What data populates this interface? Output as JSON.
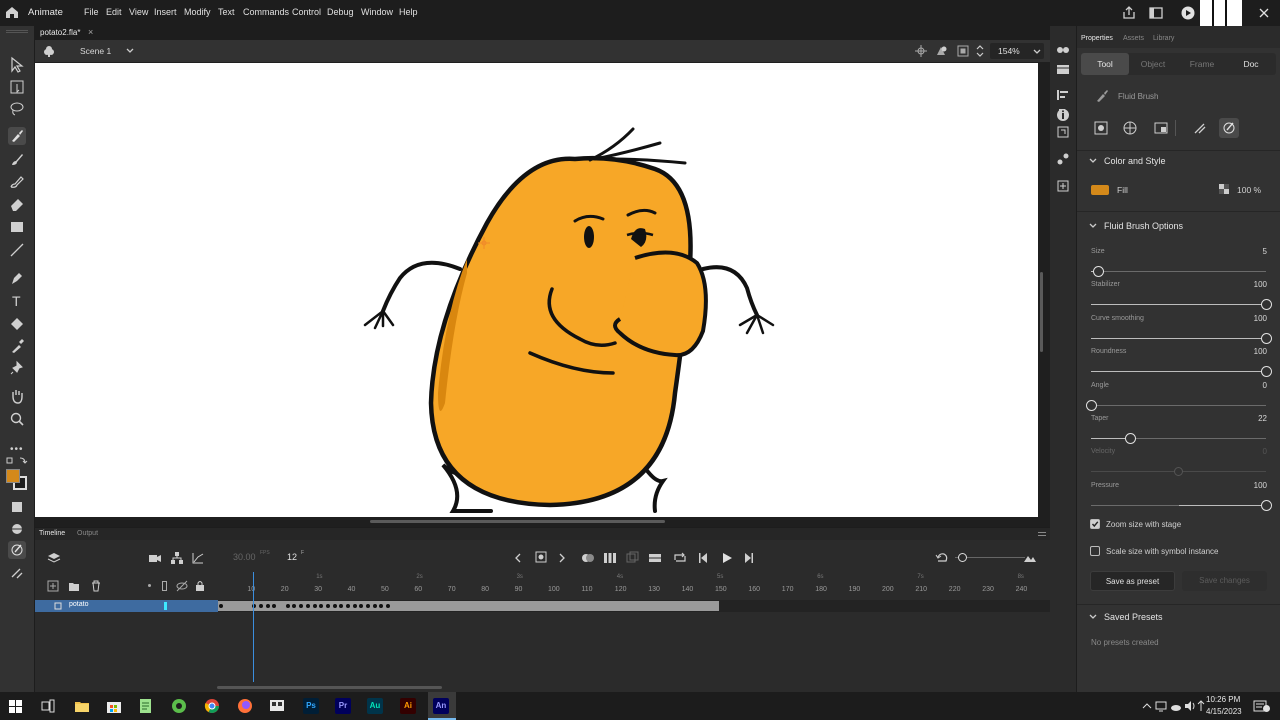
{
  "app": {
    "name": "Animate",
    "accent": "#3b8ede"
  },
  "menu": [
    "File",
    "Edit",
    "View",
    "Insert",
    "Modify",
    "Text",
    "Commands",
    "Control",
    "Debug",
    "Window",
    "Help"
  ],
  "document": {
    "tab_title": "potato2.fla*",
    "close_glyph": "×",
    "scene": "Scene 1",
    "zoom": "154%"
  },
  "stage": {
    "background": "#ffffff",
    "character_fill": "#f7a727",
    "character_shadow": "#d9870f"
  },
  "properties": {
    "panel_tabs": [
      "Properties",
      "Assets",
      "Library"
    ],
    "mode_tabs": [
      "Tool",
      "Object",
      "Frame",
      "Doc"
    ],
    "tool_name": "Fluid Brush",
    "color_style_title": "Color and Style",
    "fill_label": "Fill",
    "fill_color": "#d4891a",
    "fill_opacity": "100 %",
    "options_title": "Fluid Brush Options",
    "sliders": [
      {
        "label": "Size",
        "value": "5",
        "fraction": 0.04
      },
      {
        "label": "Stabilizer",
        "value": "100",
        "fraction": 1.0
      },
      {
        "label": "Curve smoothing",
        "value": "100",
        "fraction": 1.0
      },
      {
        "label": "Roundness",
        "value": "100",
        "fraction": 1.0
      },
      {
        "label": "Angle",
        "value": "0",
        "fraction": 0.0
      },
      {
        "label": "Taper",
        "value": "22",
        "fraction": 0.22
      },
      {
        "label": "Velocity",
        "value": "0",
        "fraction": 0.5,
        "disabled": true
      },
      {
        "label": "Pressure",
        "value": "100",
        "fraction": 1.0,
        "mixed": true
      }
    ],
    "zoom_size_label": "Zoom size with stage",
    "zoom_size_checked": true,
    "scale_size_label": "Scale size with symbol instance",
    "scale_size_checked": false,
    "save_preset": "Save as preset",
    "save_changes": "Save changes",
    "saved_presets_title": "Saved Presets",
    "no_presets": "No presets created"
  },
  "timeline": {
    "tabs": [
      "Timeline",
      "Output"
    ],
    "fps": "30.00",
    "fps_unit": "FPS",
    "current_frame": "12",
    "frame_unit": "F",
    "layer_name": "potato",
    "second_marks": [
      "1s",
      "2s",
      "3s",
      "4s",
      "5s",
      "6s",
      "7s",
      "8s"
    ],
    "frame_marks": [
      "10",
      "20",
      "30",
      "40",
      "50",
      "60",
      "70",
      "80",
      "90",
      "100",
      "110",
      "120",
      "130",
      "140",
      "150",
      "160",
      "170",
      "180",
      "190",
      "200",
      "210",
      "220",
      "230",
      "240"
    ],
    "total_frames": 150
  },
  "taskbar": {
    "time": "10:26 PM",
    "date": "4/15/2023",
    "apps": [
      "Ps",
      "Pr",
      "Au",
      "Ai",
      "An"
    ]
  }
}
